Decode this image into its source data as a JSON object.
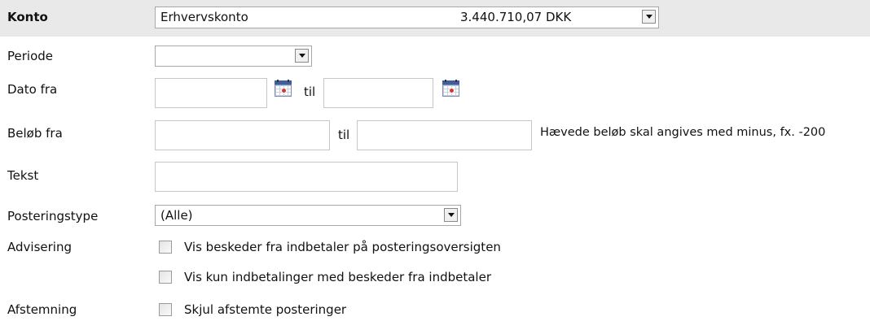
{
  "konto": {
    "label": "Konto",
    "account_name": "Erhvervskonto",
    "balance": "3.440.710,07 DKK"
  },
  "periode": {
    "label": "Periode",
    "selected": ""
  },
  "dato": {
    "label": "Dato fra",
    "til_label": "til",
    "from_value": "",
    "to_value": ""
  },
  "belob": {
    "label": "Beløb fra",
    "til_label": "til",
    "from_value": "",
    "to_value": "",
    "hint": "Hævede beløb skal angives med minus, fx. -200"
  },
  "tekst": {
    "label": "Tekst",
    "value": ""
  },
  "posteringstype": {
    "label": "Posteringstype",
    "selected": "(Alle)"
  },
  "advisering": {
    "label": "Advisering",
    "options": [
      {
        "label": "Vis beskeder fra indbetaler på posteringsoversigten",
        "checked": false
      },
      {
        "label": "Vis kun indbetalinger med beskeder fra indbetaler",
        "checked": false
      }
    ]
  },
  "afstemning": {
    "label": "Afstemning",
    "option": {
      "label": "Skjul afstemte posteringer",
      "checked": false
    }
  },
  "icons": {
    "calendar": "calendar-icon",
    "dropdown": "chevron-down-icon"
  }
}
